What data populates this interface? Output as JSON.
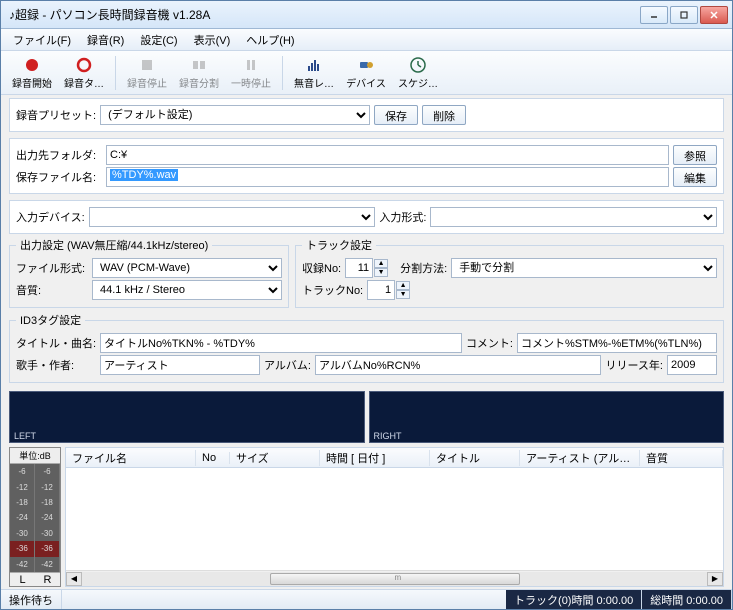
{
  "title": "♪超録 - パソコン長時間録音機 v1.28A",
  "menu": {
    "file": "ファイル(F)",
    "record": "録音(R)",
    "settings": "設定(C)",
    "view": "表示(V)",
    "help": "ヘルプ(H)"
  },
  "toolbar": {
    "rec_start": "録音開始",
    "rec_timer": "録音タ…",
    "rec_stop": "録音停止",
    "rec_split": "録音分割",
    "pause": "一時停止",
    "silence": "無音レ…",
    "device": "デバイス",
    "schedule": "スケジ…"
  },
  "preset": {
    "label": "録音プリセット:",
    "value": "(デフォルト設定)",
    "save": "保存",
    "delete": "削除"
  },
  "output": {
    "folder_label": "出力先フォルダ:",
    "folder_value": "C:¥",
    "browse": "参照",
    "filename_label": "保存ファイル名:",
    "filename_value": "%TDY%.wav",
    "edit": "編集"
  },
  "input": {
    "device_label": "入力デバイス:",
    "device_value": "",
    "format_label": "入力形式:",
    "format_value": ""
  },
  "out_settings": {
    "legend": "出力設定 (WAV無圧縮/44.1kHz/stereo)",
    "file_format_label": "ファイル形式:",
    "file_format_value": "WAV (PCM-Wave)",
    "quality_label": "音質:",
    "quality_value": "44.1 kHz / Stereo"
  },
  "track_settings": {
    "legend": "トラック設定",
    "rec_no_label": "収録No:",
    "rec_no_value": "11",
    "split_label": "分割方法:",
    "split_value": "手動で分割",
    "track_no_label": "トラックNo:",
    "track_no_value": "1"
  },
  "id3": {
    "legend": "ID3タグ設定",
    "title_label": "タイトル・曲名:",
    "title_value": "タイトルNo%TKN% - %TDY%",
    "comment_label": "コメント:",
    "comment_value": "コメント%STM%-%ETM%(%TLN%)",
    "artist_label": "歌手・作者:",
    "artist_value": "アーティスト",
    "album_label": "アルバム:",
    "album_value": "アルバムNo%RCN%",
    "year_label": "リリース年:",
    "year_value": "2009"
  },
  "wave": {
    "left": "LEFT",
    "right": "RIGHT"
  },
  "meter": {
    "unit": "単位:dB",
    "ticks": [
      "-6",
      "-12",
      "-18",
      "-24",
      "-30",
      "-36",
      "-42"
    ],
    "L": "L",
    "R": "R"
  },
  "list": {
    "cols": {
      "filename": "ファイル名",
      "no": "No",
      "size": "サイズ",
      "time_date": "時間 [ 日付 ]",
      "title": "タイトル",
      "artist": "アーティスト (アル…",
      "quality": "音質"
    },
    "scroll_mid": "m"
  },
  "status": {
    "ready": "操作待ち",
    "track": "トラック(0)時間 0:00.00",
    "total": "総時間 0:00.00"
  }
}
